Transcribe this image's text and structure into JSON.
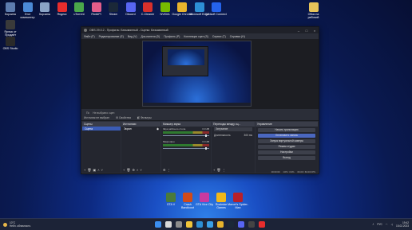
{
  "desktop": {
    "icons_top": [
      {
        "label": "Корзина",
        "color": "#5d7cae"
      },
      {
        "label": "Этот компьютер",
        "color": "#4b8ad6"
      },
      {
        "label": "Корзина",
        "color": "#8aa3c6"
      },
      {
        "label": "Яндекс",
        "color": "#e82d2d"
      },
      {
        "label": "uTorrent",
        "color": "#4aa84a"
      },
      {
        "label": "RiotAPI",
        "color": "#e35d8a"
      },
      {
        "label": "Steam",
        "color": "#1b2838"
      },
      {
        "label": "Discord",
        "color": "#5865f2"
      },
      {
        "label": "C-Cleaner",
        "color": "#d7302b"
      },
      {
        "label": "NVIDIA",
        "color": "#76b900"
      },
      {
        "label": "Google Chrome",
        "color": "#e8b42d"
      },
      {
        "label": "Microsoft Edge",
        "color": "#2d8fd5"
      },
      {
        "label": "Ubisoft Connect",
        "color": "#2563eb"
      },
      {
        "label": "Обои на рабочий",
        "color": "#e8c45a"
      }
    ],
    "icons_left": [
      {
        "label": "Ярлык от Продаёт",
        "color": "#3a3a3a"
      },
      {
        "label": "OBS Studio",
        "color": "#2a2a2a"
      }
    ],
    "games": [
      {
        "label": "GTA V",
        "color": "#4a7a3a"
      },
      {
        "label": "Crash Bandicoot",
        "color": "#d04a1a"
      },
      {
        "label": "GTA Vice City",
        "color": "#c83aa0"
      },
      {
        "label": "Rockstar Games",
        "color": "#f0b81a"
      },
      {
        "label": "Marvel's Spider-Man",
        "color": "#b8202a"
      }
    ]
  },
  "obs": {
    "title": "OBS 29.0.2 - Профиль: Безымянный - Сцены: Безымянный",
    "menu": [
      "Файл (F)",
      "Редактирование (E)",
      "Вид (V)",
      "Док-панели (D)",
      "Профиль (P)",
      "Коллекция сцен (S)",
      "Сервис (T)",
      "Справка (H)"
    ],
    "status_strip": {
      "icon": "Пс",
      "text": "Не выбрано сцен"
    },
    "source_toolbar": {
      "label": "Источник не выбран",
      "properties": "Свойства",
      "filters": "Фильтры"
    },
    "docks": {
      "scenes": {
        "title": "Сцены",
        "items": [
          "Сцена"
        ]
      },
      "sources": {
        "title": "Источники",
        "items": [
          "Экран"
        ]
      },
      "mixer": {
        "title": "Микшер звука",
        "channels": [
          {
            "name": "Звук рабочего стола",
            "db": "0.0 dB"
          },
          {
            "name": "Микрофон",
            "db": "0.0 dB"
          }
        ]
      },
      "transitions": {
        "title": "Переходы между сц...",
        "type": "Затухание",
        "duration_label": "Длительность",
        "duration": "300 ms"
      },
      "controls": {
        "title": "Управление",
        "buttons": [
          "Начать трансляцию",
          "Остановить запись",
          "Запуск виртуальной камеры",
          "Режим студии",
          "Настройки",
          "Выход"
        ]
      }
    },
    "statusbar": [
      "00:00:00",
      "CPU: 3.9%",
      "60.00 / 60.00 FPS"
    ]
  },
  "taskbar": {
    "weather": {
      "temp": "10°C",
      "desc": "Небл. облачность"
    },
    "apps": [
      {
        "name": "start-icon",
        "color": "#3b8ef0"
      },
      {
        "name": "search-icon",
        "color": "#d8d8d8"
      },
      {
        "name": "taskview-icon",
        "color": "#8c8c8c"
      },
      {
        "name": "explorer-icon",
        "color": "#f0c43a"
      },
      {
        "name": "edge-icon",
        "color": "#2d8fd5"
      },
      {
        "name": "store-icon",
        "color": "#3aa0e8"
      },
      {
        "name": "chrome-icon",
        "color": "#e8b42d"
      },
      {
        "name": "steam-icon",
        "color": "#1b2838"
      },
      {
        "name": "discord-icon",
        "color": "#5865f2"
      },
      {
        "name": "obs-icon",
        "color": "#444"
      },
      {
        "name": "yandex-icon",
        "color": "#e82d2d"
      }
    ],
    "tray": {
      "lang": "РУС",
      "time": "19:42",
      "date": "15.02.2023"
    }
  }
}
